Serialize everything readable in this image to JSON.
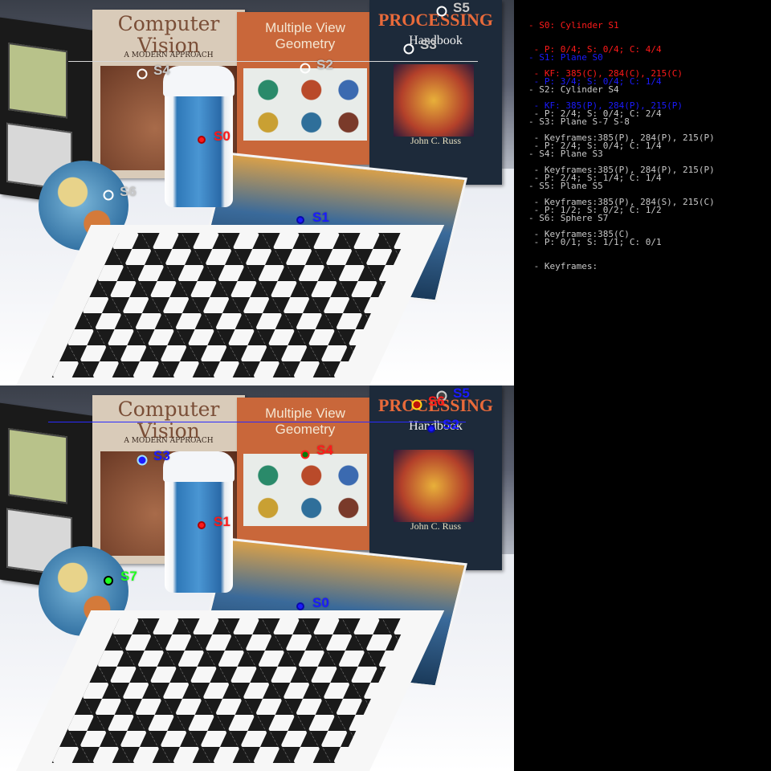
{
  "colors": {
    "red": "#ff1a1a",
    "blue": "#1b1bff",
    "gray": "#c8c8c8",
    "green": "#1fff1f",
    "background": "#000000"
  },
  "scene_text": {
    "cv_title": "Computer Vision",
    "cv_subtitle": "A MODERN APPROACH",
    "mvg_title": "Multiple View Geometry",
    "ip_title": "PROCESSING",
    "ip_subtitle": "Handbook",
    "ip_author": "John C. Russ"
  },
  "top_frame": {
    "markers": [
      {
        "label": "S0",
        "color": "red"
      },
      {
        "label": "S1",
        "color": "blue"
      },
      {
        "label": "S2",
        "color": "gray"
      },
      {
        "label": "S3",
        "color": "gray"
      },
      {
        "label": "S4",
        "color": "gray"
      },
      {
        "label": "S5",
        "color": "gray"
      },
      {
        "label": "S6",
        "color": "gray"
      }
    ]
  },
  "bottom_frame": {
    "markers": [
      {
        "label": "S0",
        "color": "blue"
      },
      {
        "label": "S1",
        "color": "red"
      },
      {
        "label": "S2",
        "color": "blue"
      },
      {
        "label": "S3",
        "color": "blue"
      },
      {
        "label": "S4",
        "color": "red"
      },
      {
        "label": "S5",
        "color": "blue"
      },
      {
        "label": "S6",
        "color": "red"
      },
      {
        "label": "S7",
        "color": "green"
      }
    ]
  },
  "legend": [
    {
      "color": "red",
      "lines": [
        "- S0: Cylinder S1",
        " - P: 0/4; S: 0/4; C: 4/4",
        " - KF: 385(C), 284(C), 215(C)"
      ]
    },
    {
      "color": "blue",
      "lines": [
        "- S1: Plane S0",
        " - P: 3/4; S: 0/4; C: 1/4",
        " - KF: 385(P), 284(P), 215(P)"
      ]
    },
    {
      "color": "gray",
      "lines": [
        "- S2: Cylinder S4",
        " - P: 2/4; S: 0/4; C: 2/4",
        " - Keyframes:385(P), 284(P), 215(P)"
      ]
    },
    {
      "color": "gray",
      "lines": [
        "- S3: Plane S-7 S-8",
        " - P: 2/4; S: 0/4; C: 1/4",
        " - Keyframes:385(P), 284(P), 215(P)"
      ]
    },
    {
      "color": "gray",
      "lines": [
        "- S4: Plane S3",
        " - P: 2/4; S: 1/4; C: 1/4",
        " - Keyframes:385(P), 284(S), 215(C)"
      ]
    },
    {
      "color": "gray",
      "lines": [
        "- S5: Plane S5",
        " - P: 1/2; S: 0/2; C: 1/2",
        " - Keyframes:385(C)"
      ]
    },
    {
      "color": "gray",
      "lines": [
        "- S6: Sphere S7",
        " - P: 0/1; S: 1/1; C: 0/1",
        " - Keyframes:"
      ]
    }
  ]
}
